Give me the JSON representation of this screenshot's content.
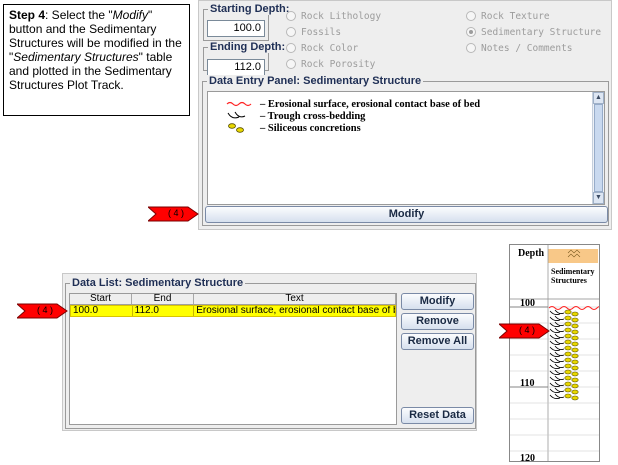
{
  "step_note": {
    "step_label": "Step 4",
    "t1": ": Select the \"",
    "t2": "Modify",
    "t3": "\" button and the Sedimentary Structures will be modified in the \"",
    "t4": "Sedimentary Structures",
    "t5": "\" table and plotted in the Sedimentary Structures Plot Track."
  },
  "depth": {
    "start_label": "Starting Depth:",
    "start_value": "100.0",
    "end_label": "Ending Depth:",
    "end_value": "112.0"
  },
  "options": [
    {
      "label": "Rock Lithology",
      "selected": false
    },
    {
      "label": "Rock Texture",
      "selected": false
    },
    {
      "label": "Fossils",
      "selected": false
    },
    {
      "label": "Sedimentary Structure",
      "selected": true
    },
    {
      "label": "Rock Color",
      "selected": false
    },
    {
      "label": "Notes / Comments",
      "selected": false
    },
    {
      "label": "Rock Porosity",
      "selected": false
    }
  ],
  "entry_panel": {
    "title": "Data Entry Panel: Sedimentary Structure",
    "items": [
      {
        "icon": "erosional-surface-icon",
        "text": "– Erosional surface, erosional contact base of bed"
      },
      {
        "icon": "trough-cross-bedding-icon",
        "text": "– Trough cross-bedding"
      },
      {
        "icon": "siliceous-concretions-icon",
        "text": "– Siliceous concretions"
      }
    ],
    "modify_label": "Modify"
  },
  "data_list": {
    "title": "Data List: Sedimentary Structure",
    "columns": [
      "Start",
      "End",
      "Text"
    ],
    "rows": [
      {
        "start": "100.0",
        "end": "112.0",
        "text": "Erosional surface, erosional contact base of b..."
      }
    ],
    "buttons": {
      "modify": "Modify",
      "remove": "Remove",
      "remove_all": "Remove All",
      "reset": "Reset Data"
    }
  },
  "plot": {
    "depth_label": "Depth",
    "track_label": "Sedimentary Structures",
    "ticks": [
      "100",
      "110",
      "120"
    ]
  },
  "callouts": [
    "( 4 )",
    "( 4 )",
    "( 4 )"
  ],
  "colors": {
    "highlight": "#ffff00",
    "arrow": "#ff0000",
    "track_header": "#f8c888",
    "concretion": "#e8d800"
  }
}
